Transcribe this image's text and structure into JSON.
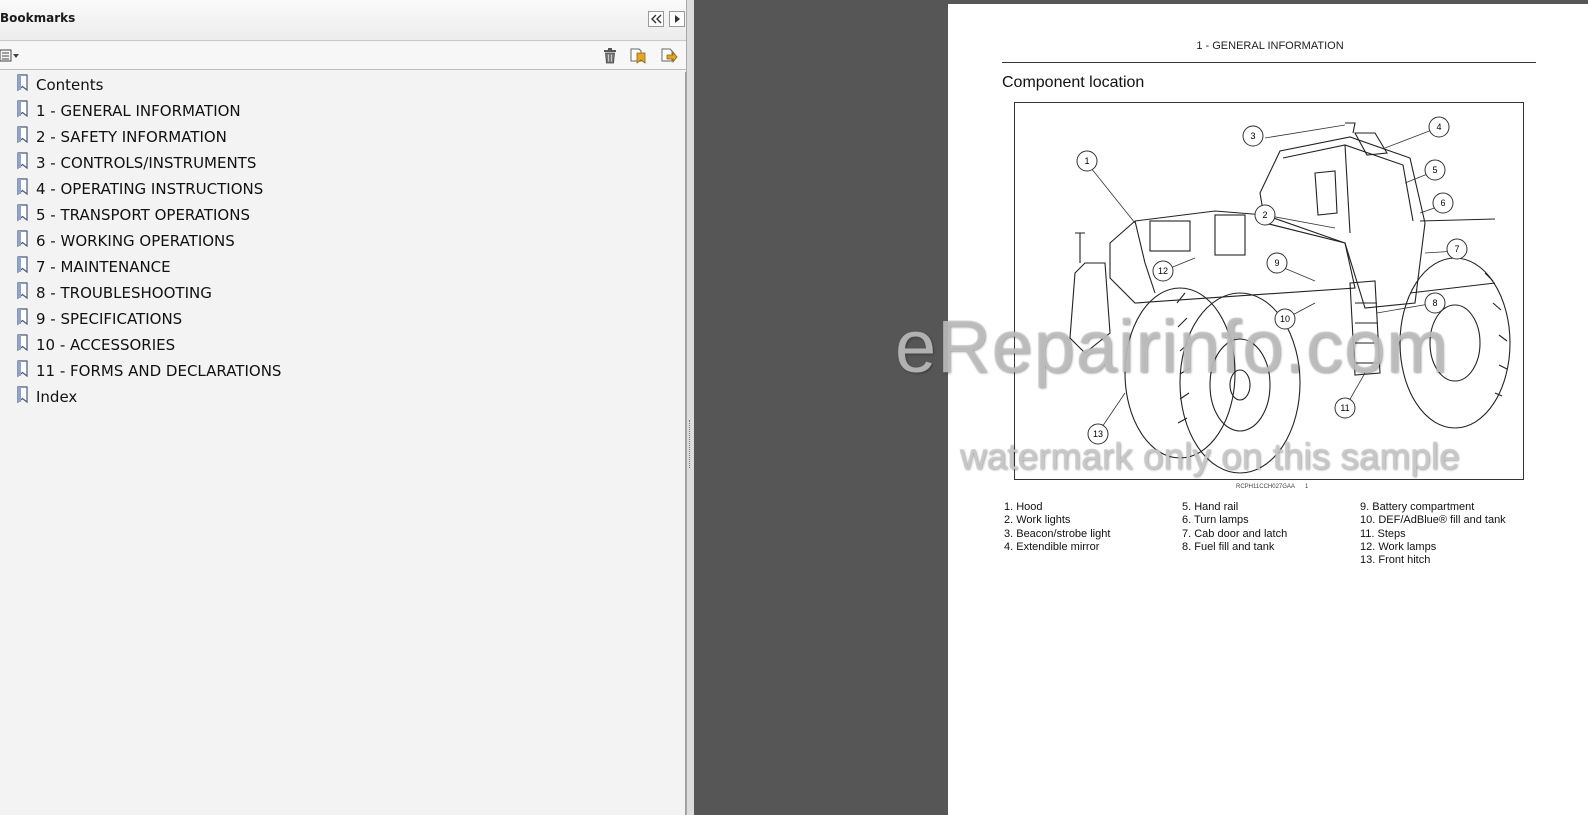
{
  "bookmarks_panel": {
    "title": "Bookmarks",
    "collapse_tooltip_icon": "double-chevron-left-icon",
    "expand_icon": "chevron-right-icon",
    "options_icon": "options-menu-icon",
    "delete_icon": "trash-icon",
    "new_bookmark_icon": "new-bookmark-icon",
    "expand_bookmark_icon": "expand-bookmark-icon",
    "items": [
      {
        "label": "Contents"
      },
      {
        "label": "1 - GENERAL INFORMATION"
      },
      {
        "label": "2 - SAFETY INFORMATION"
      },
      {
        "label": "3 - CONTROLS/INSTRUMENTS"
      },
      {
        "label": "4 - OPERATING INSTRUCTIONS"
      },
      {
        "label": "5 - TRANSPORT OPERATIONS"
      },
      {
        "label": "6 - WORKING OPERATIONS"
      },
      {
        "label": "7 - MAINTENANCE"
      },
      {
        "label": "8 - TROUBLESHOOTING"
      },
      {
        "label": "9 - SPECIFICATIONS"
      },
      {
        "label": "10 - ACCESSORIES"
      },
      {
        "label": "11 - FORMS AND DECLARATIONS"
      },
      {
        "label": "Index"
      }
    ]
  },
  "document": {
    "running_header": "1 - GENERAL INFORMATION",
    "section_title": "Component location",
    "figure_code": "RCPH11CCH027GAA",
    "figure_number": "1",
    "callouts": [
      "1",
      "2",
      "3",
      "4",
      "5",
      "6",
      "7",
      "8",
      "9",
      "10",
      "11",
      "12",
      "13"
    ],
    "legend": [
      [
        "1.  Hood",
        "2.  Work lights",
        "3.  Beacon/strobe light",
        "4.  Extendible mirror"
      ],
      [
        "5.  Hand rail",
        "6.  Turn lamps",
        "7.  Cab door and latch",
        "8.  Fuel fill and tank"
      ],
      [
        "9.  Battery compartment",
        "10. DEF/AdBlue® fill and tank",
        "11.  Steps",
        "12.  Work lamps",
        "13.  Front hitch"
      ]
    ]
  },
  "watermark": {
    "line1": "eRepairinfo.com",
    "line2": "watermark only on this sample"
  }
}
